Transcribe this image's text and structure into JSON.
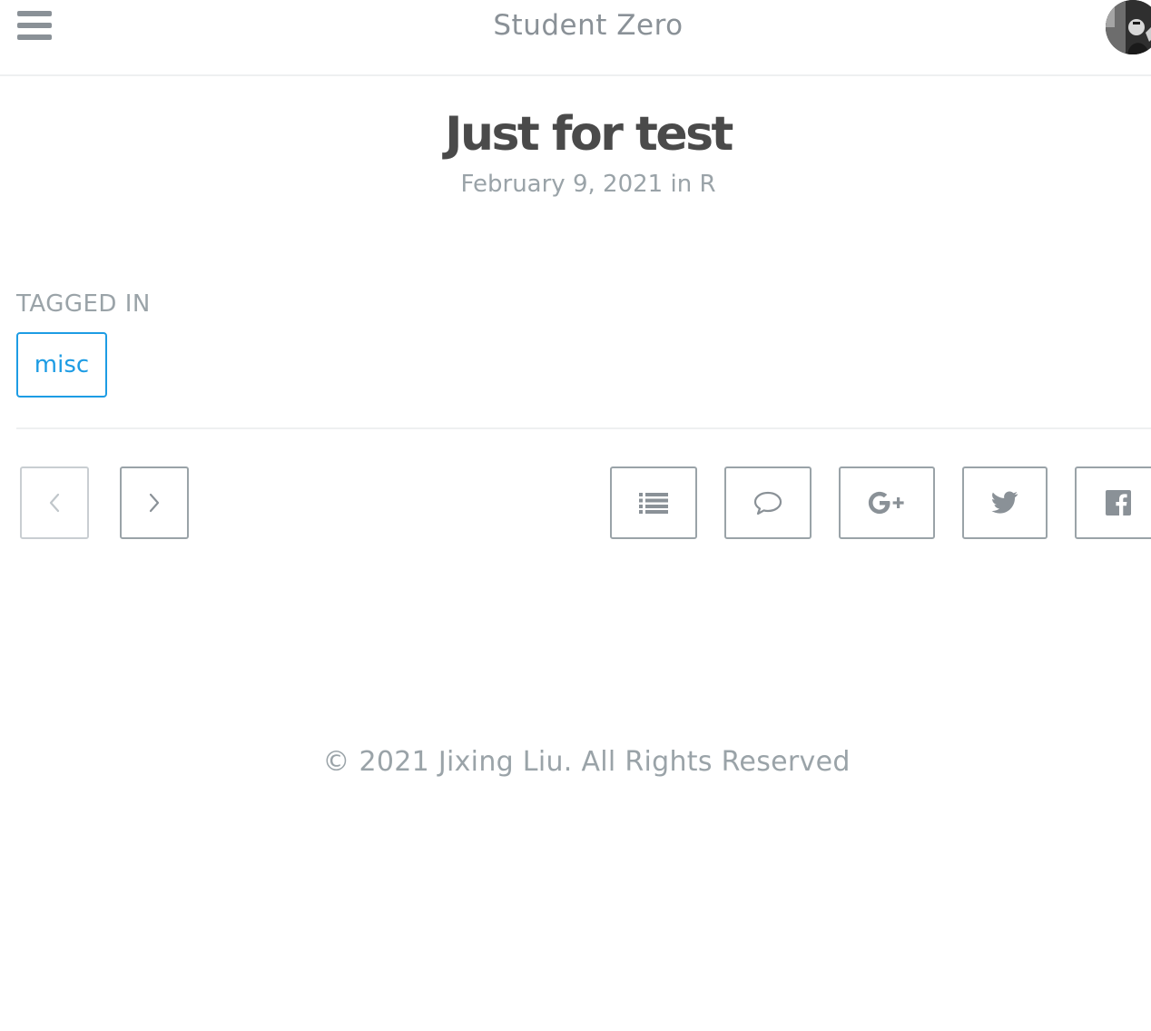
{
  "header": {
    "title": "Student Zero",
    "menu_icon": "hamburger-menu-icon",
    "avatar": "author-avatar"
  },
  "post": {
    "title": "Just for test",
    "date": "February 9, 2021",
    "in_word": "in",
    "category": "R"
  },
  "tags": {
    "label": "TAGGED IN",
    "items": [
      "misc"
    ]
  },
  "actions": {
    "prev_icon": "chevron-left-icon",
    "next_icon": "chevron-right-icon",
    "toc_icon": "list-icon",
    "comments_icon": "speech-bubble-icon",
    "share_google_icon": "google-plus-icon",
    "share_twitter_icon": "twitter-icon",
    "share_facebook_icon": "facebook-icon"
  },
  "footer": {
    "copyright": "© 2021 Jixing Liu. All Rights Reserved"
  },
  "colors": {
    "accent": "#1d9ce4",
    "text_muted": "#9aa3a8",
    "title": "#4a4a4a",
    "border": "#9aa3a8"
  }
}
